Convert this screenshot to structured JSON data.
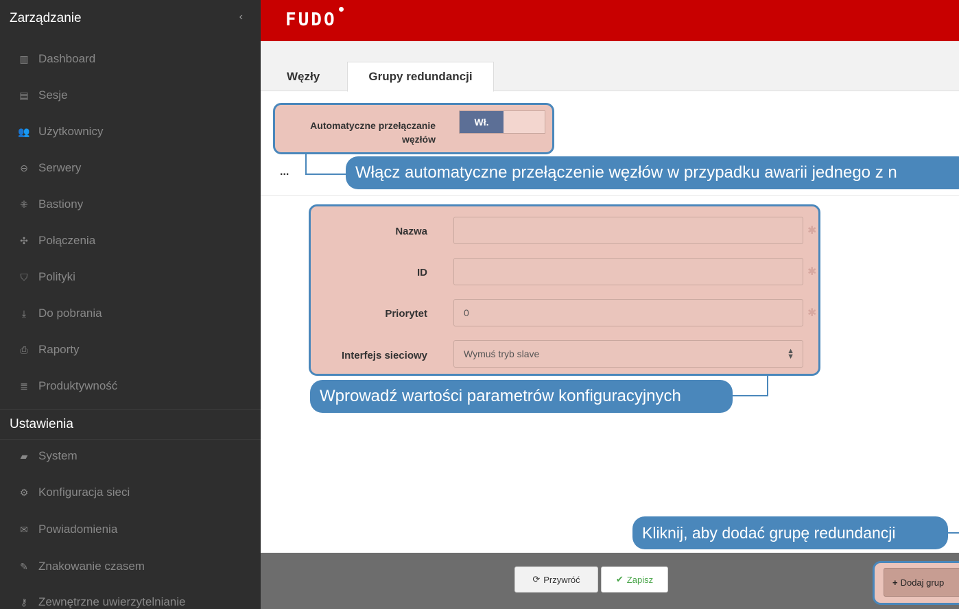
{
  "sidebar": {
    "section_title": "Zarządzanie",
    "collapse_glyph": "‹",
    "items": [
      {
        "label": "Dashboard",
        "icon": "▥",
        "icon_name": "dashboard-icon"
      },
      {
        "label": "Sesje",
        "icon": "▤",
        "icon_name": "film-icon"
      },
      {
        "label": "Użytkownicy",
        "icon": "👥",
        "icon_name": "users-icon"
      },
      {
        "label": "Serwery",
        "icon": "⊖",
        "icon_name": "server-icon"
      },
      {
        "label": "Bastiony",
        "icon": "⁜",
        "icon_name": "bastion-icon"
      },
      {
        "label": "Połączenia",
        "icon": "✣",
        "icon_name": "connections-icon"
      },
      {
        "label": "Polityki",
        "icon": "⛉",
        "icon_name": "shield-icon"
      },
      {
        "label": "Do pobrania",
        "icon": "⤓",
        "icon_name": "download-icon"
      },
      {
        "label": "Raporty",
        "icon": "⎙",
        "icon_name": "print-icon"
      },
      {
        "label": "Produktywność",
        "icon": "≣",
        "icon_name": "productivity-icon"
      }
    ],
    "settings_title": "Ustawienia",
    "settings_items": [
      {
        "label": "System",
        "icon": "▰",
        "icon_name": "folder-icon"
      },
      {
        "label": "Konfiguracja sieci",
        "icon": "⚙",
        "icon_name": "gears-icon"
      },
      {
        "label": "Powiadomienia",
        "icon": "✉",
        "icon_name": "envelope-icon"
      },
      {
        "label": "Znakowanie czasem",
        "icon": "✎",
        "icon_name": "edit-icon"
      },
      {
        "label": "Zewnętrzne uwierzytelnianie",
        "icon": "⚷",
        "icon_name": "key-icon"
      }
    ]
  },
  "header": {
    "logo": "FUDO"
  },
  "tabs": [
    {
      "label": "Węzły"
    },
    {
      "label": "Grupy redundancji"
    }
  ],
  "auto_switch": {
    "label_line1": "Automatyczne przełączanie",
    "label_line2": "węzłów",
    "toggle_on_label": "Wł.",
    "ellipsis": "..."
  },
  "form": {
    "name_label": "Nazwa",
    "name_value": "",
    "id_label": "ID",
    "id_value": "",
    "priority_label": "Priorytet",
    "priority_value": "0",
    "interface_label": "Interfejs sieciowy",
    "interface_value": "Wymuś tryb slave",
    "required_marker": "✱"
  },
  "callouts": {
    "auto": "Włącz automatyczne przełączenie węzłów w przypadku awarii jednego z n",
    "form": "Wprowadź wartości parametrów konfiguracyjnych",
    "add": "Kliknij, aby dodać grupę redundancji"
  },
  "footer": {
    "restore_label": "Przywróć",
    "save_label": "Zapisz",
    "add_label": "Dodaj grup"
  },
  "colors": {
    "header_red": "#c80000",
    "sidebar_bg": "#2e2e2e",
    "callout_blue": "#4a87bb",
    "highlight": "#ebc4bb",
    "save_green": "#47a447"
  }
}
